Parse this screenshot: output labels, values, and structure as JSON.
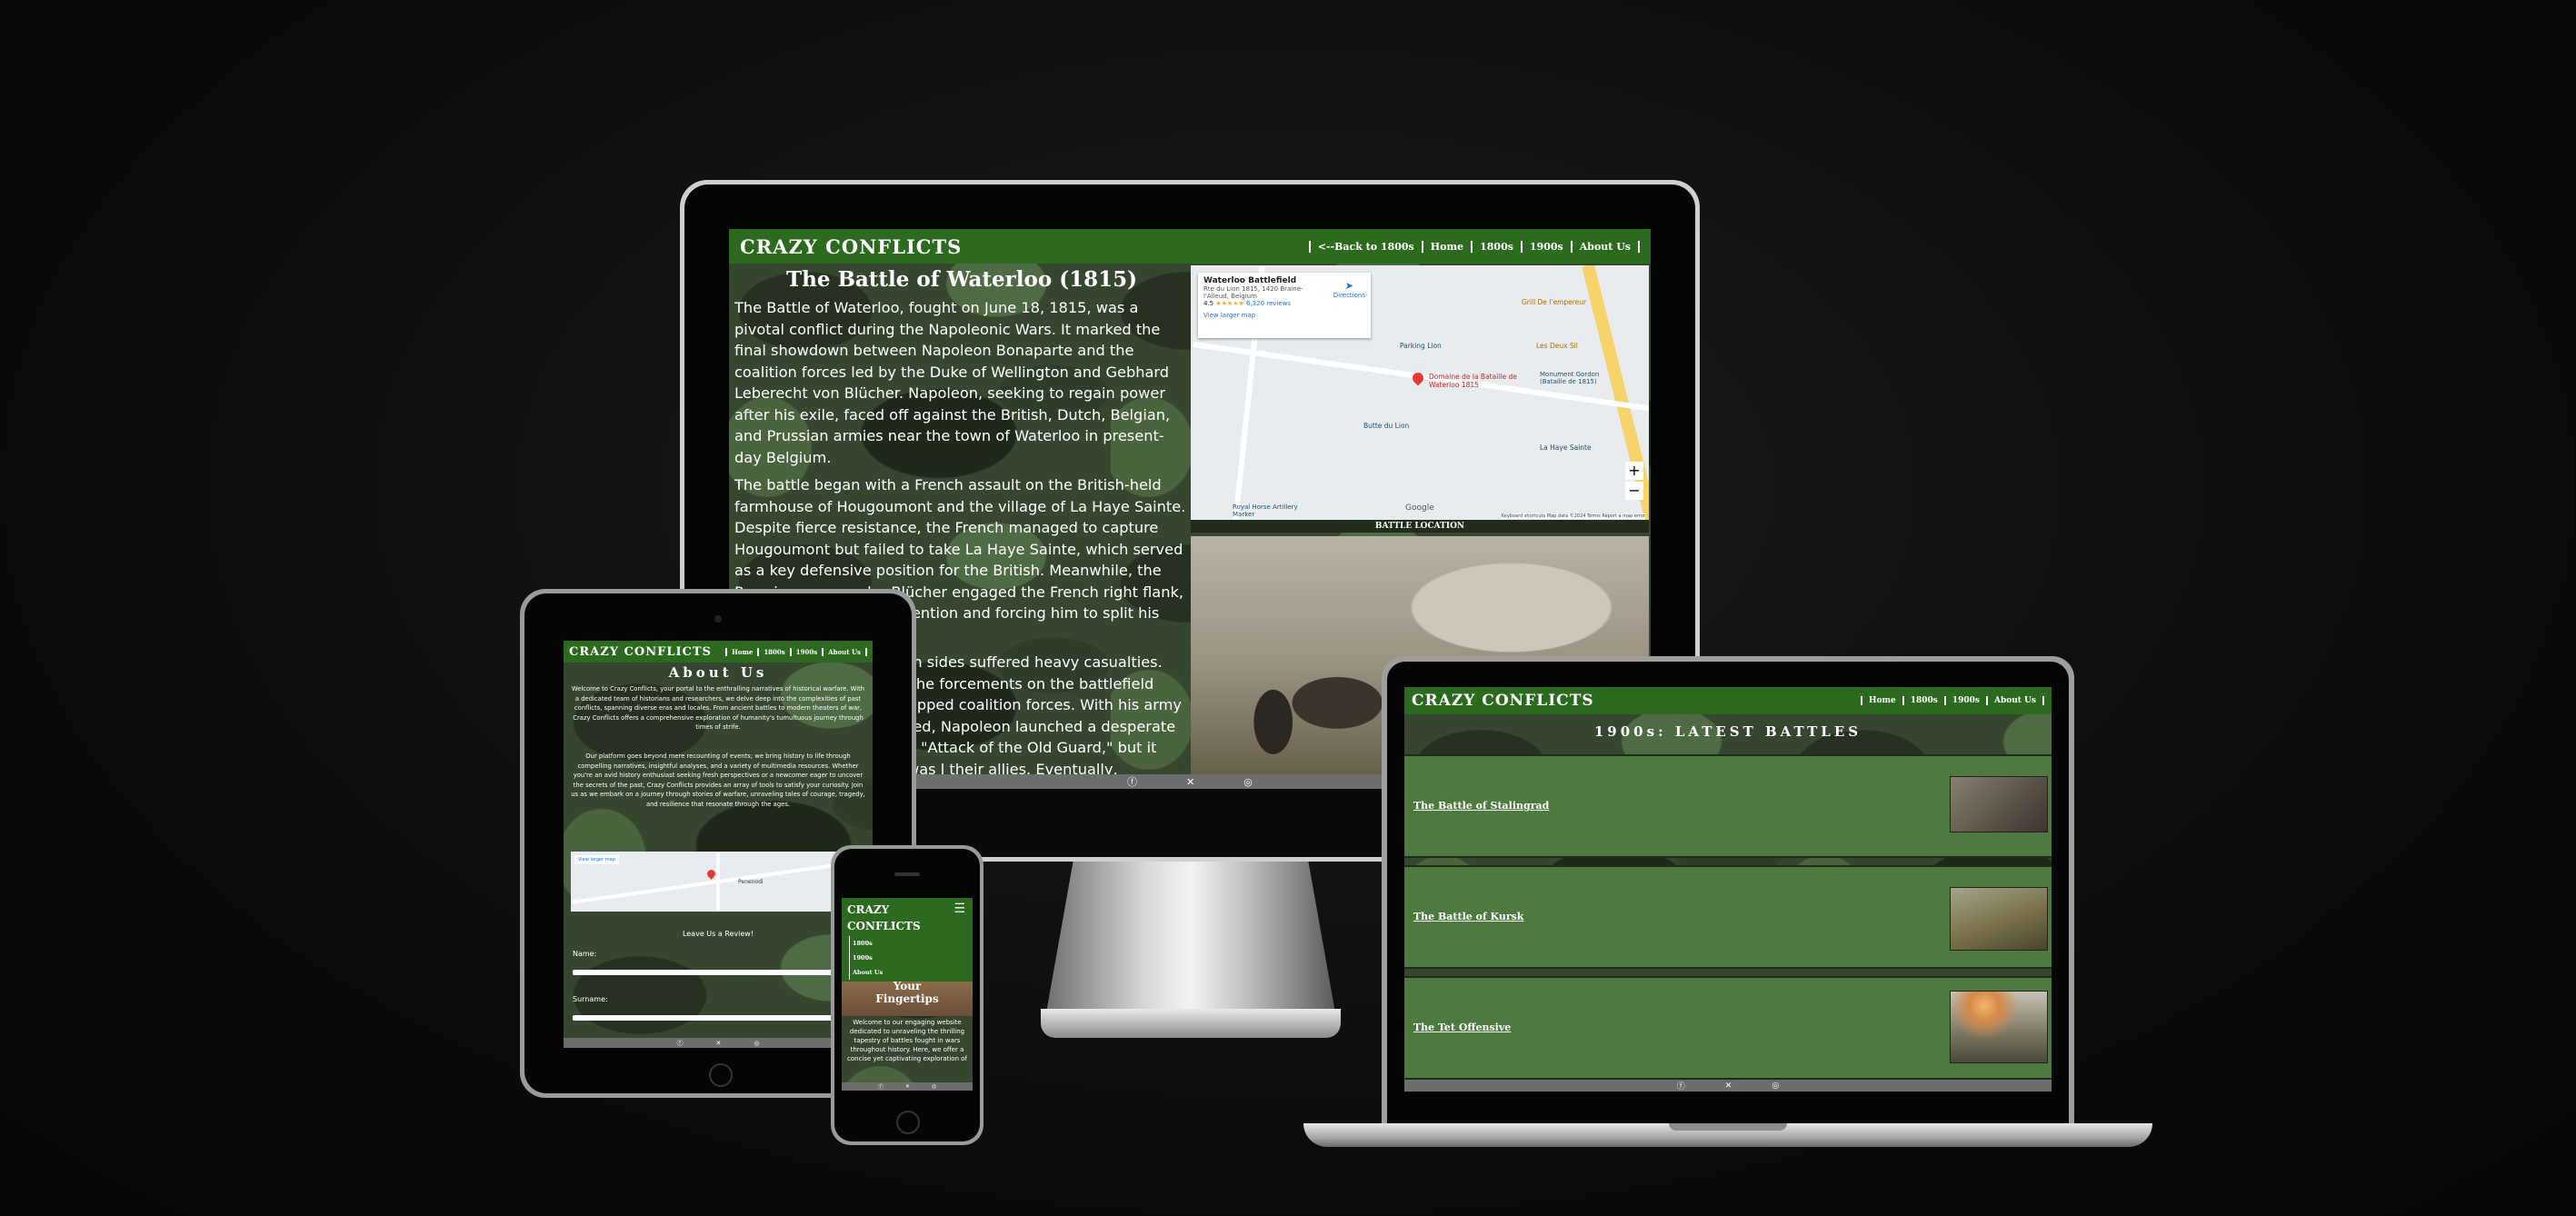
{
  "brand": "CRAZY CONFLICTS",
  "footer_icons": [
    "facebook-icon",
    "x-icon",
    "instagram-icon"
  ],
  "desktop": {
    "nav": [
      "<--Back to 1800s",
      "Home",
      "1800s",
      "1900s",
      "About Us"
    ],
    "title": "The Battle of Waterloo (1815)",
    "paragraphs": [
      "The Battle of Waterloo, fought on June 18, 1815, was a pivotal conflict during the Napoleonic Wars. It marked the final showdown between Napoleon Bonaparte and the coalition forces led by the Duke of Wellington and Gebhard Leberecht von Blücher. Napoleon, seeking to regain power after his exile, faced off against the British, Dutch, Belgian, and Prussian armies near the town of Waterloo in present-day Belgium.",
      "The battle began with a French assault on the British-held farmhouse of Hougoumont and the village of La Haye Sainte. Despite fierce resistance, the French managed to capture Hougoumont but failed to take La Haye Sainte, which served as a key defensive position for the British. Meanwhile, the Prussian army under Blücher engaged the French right flank, diverting Napoleon's attention and forcing him to split his forces.",
      "th sides suffered heavy casualties. The forcements on the battlefield tipped coalition forces. With his army ted, Napoleon launched a desperate e \"Attack of the Old Guard,\" but it was l their allies. Eventually, Napoleon's ng to his final abdication and and of Saint Helena."
    ],
    "map": {
      "place": "Waterloo Battlefield",
      "address": "Rte du Lion 1815, 1420 Braine-l'Alleud, Belgium",
      "rating": "4.5",
      "stars": "★★★★★",
      "reviews": "6,320 reviews",
      "directions": "Directions",
      "view_larger": "View larger map",
      "labels": [
        "Grill De l'empereur",
        "Parking Lion",
        "Les Deux Sil",
        "Domaine de la Bataille de Waterloo 1815",
        "Monument Gordon (Bataille de 1815)",
        "Butte du Lion",
        "La Haye Sainte",
        "Royal Horse Artillery Marker"
      ],
      "google": "Google",
      "attribution": "Keyboard shortcuts   Map data ©2024   Terms   Report a map error"
    },
    "caption": "BATTLE LOCATION"
  },
  "tablet": {
    "nav": [
      "Home",
      "1800s",
      "1900s",
      "About Us"
    ],
    "title": "About Us",
    "paragraphs": [
      "Welcome to Crazy Conflicts, your portal to the enthralling narratives of historical warfare. With a dedicated team of historians and researchers, we delve deep into the complexities of past conflicts, spanning diverse eras and locales. From ancient battles to modern theaters of war, Crazy Conflicts offers a comprehensive exploration of humanity's tumultuous journey through times of strife.",
      "Our platform goes beyond mere recounting of events; we bring history to life through compelling narratives, insightful analyses, and a variety of multimedia resources. Whether you're an avid history enthusiast seeking fresh perspectives or a newcomer eager to uncover the secrets of the past, Crazy Conflicts provides an array of tools to satisfy your curiosity. Join us as we embark on a journey through stories of warfare, unraveling tales of courage, tragedy, and resilience that resonate through the ages."
    ],
    "map_label": "Penenodi",
    "map_btn": "View larger map",
    "review_heading": "Leave Us a Review!",
    "name_label": "Name:",
    "surname_label": "Surname:"
  },
  "phone": {
    "brand_lines": [
      "CRAZY",
      "CONFLICTS"
    ],
    "nav": [
      "1800s",
      "1900s",
      "About Us"
    ],
    "hero": [
      "Your",
      "Fingertips"
    ],
    "intro": "Welcome to our engaging website dedicated to unraveling the thrilling tapestry of battles fought in wars throughout history. Here, we offer a concise yet captivating exploration of"
  },
  "laptop": {
    "nav": [
      "Home",
      "1800s",
      "1900s",
      "About Us"
    ],
    "heading": "1900s: LATEST BATTLES",
    "battles": [
      "The Battle of Stalingrad",
      "The Battle of Kursk",
      "The Tet Offensive"
    ]
  }
}
